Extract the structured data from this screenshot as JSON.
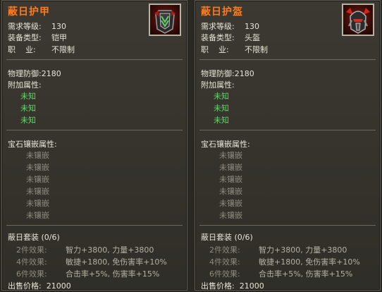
{
  "panels": [
    {
      "id": "armor",
      "title": "蔽日护甲",
      "icon": "chest-armor-icon",
      "req_level_label": "需求等级:",
      "req_level": "130",
      "equip_type_label": "装备类型:",
      "equip_type": "铠甲",
      "job_label": "职    业:",
      "job": "不限制",
      "phys_def": "物理防御:2180",
      "extra_attr_label": "附加属性:",
      "extra_attrs": [
        "未知",
        "未知",
        "未知"
      ],
      "gem_label": "宝石镶嵌属性:",
      "gems": [
        "未镶嵌",
        "未镶嵌",
        "未镶嵌",
        "未镶嵌",
        "未镶嵌",
        "未镶嵌"
      ],
      "set_name": "蔽日套装 (0/6)",
      "set_effects": [
        {
          "k": "2件效果:",
          "v": "智力+3800, 力量+3800"
        },
        {
          "k": "4件效果:",
          "v": "敏捷+1800, 免伤害率+10%"
        },
        {
          "k": "6件效果:",
          "v": "合击率+5%, 伤害率+15%"
        }
      ],
      "price": "出售价格:  21000"
    },
    {
      "id": "helmet",
      "title": "蔽日护盔",
      "icon": "helmet-icon",
      "req_level_label": "需求等级:",
      "req_level": "130",
      "equip_type_label": "装备类型:",
      "equip_type": "头盔",
      "job_label": "职    业:",
      "job": "不限制",
      "phys_def": "物理防御:2180",
      "extra_attr_label": "附加属性:",
      "extra_attrs": [
        "未知",
        "未知",
        "未知"
      ],
      "gem_label": "宝石镶嵌属性:",
      "gems": [
        "未镶嵌",
        "未镶嵌",
        "未镶嵌",
        "未镶嵌",
        "未镶嵌",
        "未镶嵌"
      ],
      "set_name": "蔽日套装 (0/6)",
      "set_effects": [
        {
          "k": "2件效果:",
          "v": "智力+3800, 力量+3800"
        },
        {
          "k": "4件效果:",
          "v": "敏捷+1800, 免伤害率+10%"
        },
        {
          "k": "6件效果:",
          "v": "合击率+5%, 伤害率+15%"
        }
      ],
      "price": "出售价格:  21000"
    }
  ],
  "colors": {
    "title": "#ff7a1c",
    "unknown_attr": "#62d66a",
    "text": "#e8e4d8",
    "dim": "#8e8a80"
  }
}
